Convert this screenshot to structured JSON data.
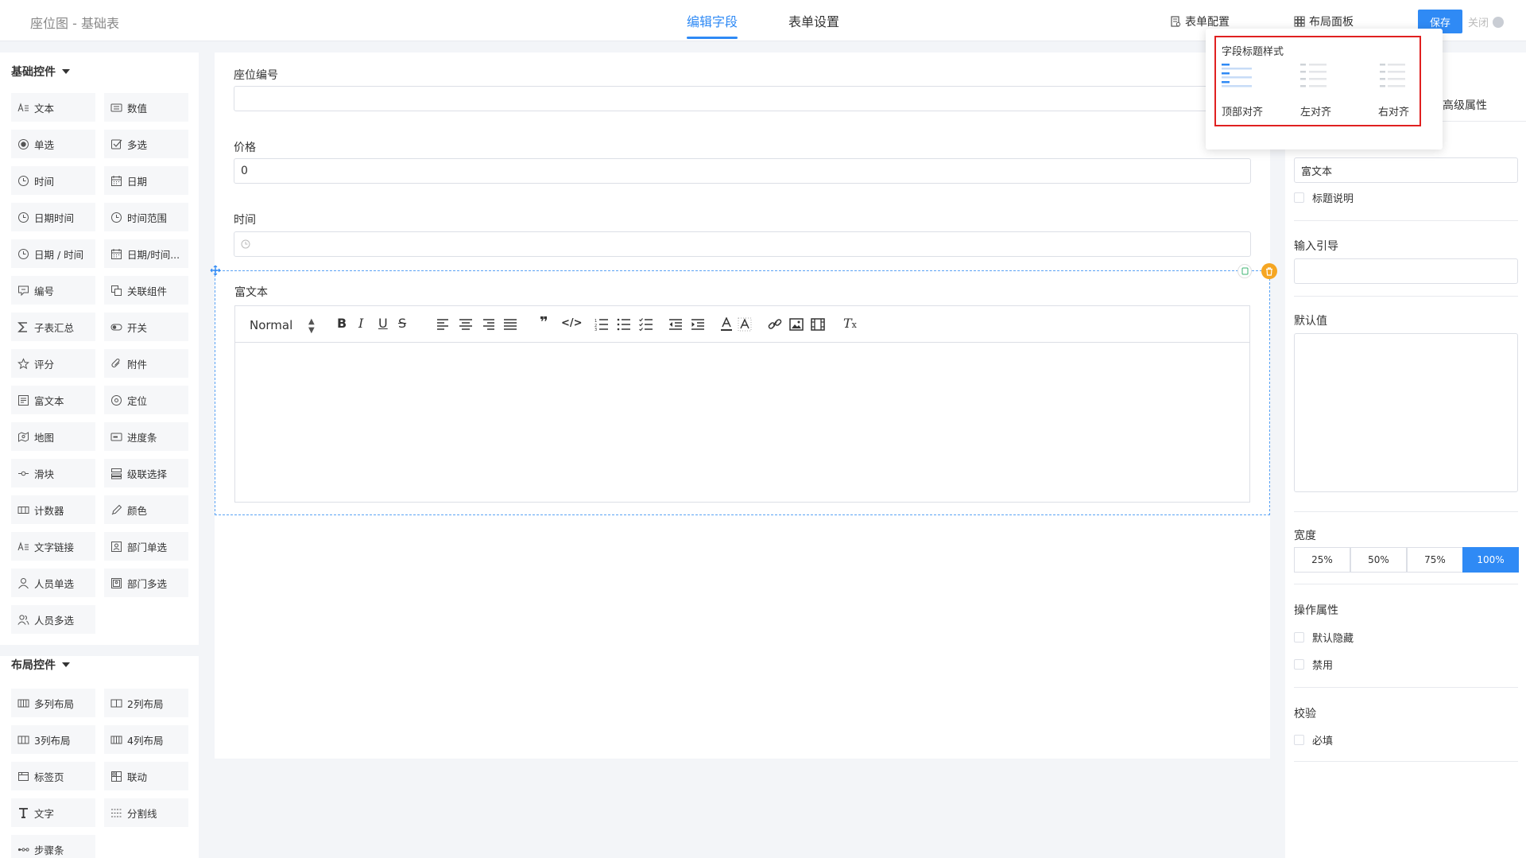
{
  "header": {
    "title": "座位图 - 基础表",
    "tabs": [
      "编辑字段",
      "表单设置"
    ],
    "form_config": "表单配置",
    "layout_panel": "布局面板",
    "save": "保存",
    "close": "关闭",
    "accent_color": "#2f8af5"
  },
  "left_panel": {
    "basic_group": "基础控件",
    "basic_controls": [
      {
        "label": "文本",
        "icon": "text-icon"
      },
      {
        "label": "数值",
        "icon": "number-icon"
      },
      {
        "label": "单选",
        "icon": "radio-icon"
      },
      {
        "label": "多选",
        "icon": "checkbox-icon"
      },
      {
        "label": "时间",
        "icon": "clock-icon"
      },
      {
        "label": "日期",
        "icon": "calendar-icon"
      },
      {
        "label": "日期时间",
        "icon": "clock-icon"
      },
      {
        "label": "时间范围",
        "icon": "clock-icon"
      },
      {
        "label": "日期 / 时间",
        "icon": "clock-icon"
      },
      {
        "label": "日期/时间...",
        "icon": "calendar-icon"
      },
      {
        "label": "编号",
        "icon": "serial-icon"
      },
      {
        "label": "关联组件",
        "icon": "link-component-icon"
      },
      {
        "label": "子表汇总",
        "icon": "sigma-icon"
      },
      {
        "label": "开关",
        "icon": "toggle-icon"
      },
      {
        "label": "评分",
        "icon": "star-icon"
      },
      {
        "label": "附件",
        "icon": "paperclip-icon"
      },
      {
        "label": "富文本",
        "icon": "richtext-icon"
      },
      {
        "label": "定位",
        "icon": "location-icon"
      },
      {
        "label": "地图",
        "icon": "map-icon"
      },
      {
        "label": "进度条",
        "icon": "progress-icon"
      },
      {
        "label": "滑块",
        "icon": "slider-icon"
      },
      {
        "label": "级联选择",
        "icon": "cascade-icon"
      },
      {
        "label": "计数器",
        "icon": "counter-icon"
      },
      {
        "label": "颜色",
        "icon": "color-picker-icon"
      },
      {
        "label": "文字链接",
        "icon": "text-link-icon"
      },
      {
        "label": "部门单选",
        "icon": "department-icon"
      },
      {
        "label": "人员单选",
        "icon": "user-icon"
      },
      {
        "label": "部门多选",
        "icon": "department-multi-icon"
      },
      {
        "label": "人员多选",
        "icon": "users-icon"
      }
    ],
    "layout_group": "布局控件",
    "layout_controls": [
      {
        "label": "多列布局",
        "icon": "columns-icon"
      },
      {
        "label": "2列布局",
        "icon": "two-columns-icon"
      },
      {
        "label": "3列布局",
        "icon": "three-columns-icon"
      },
      {
        "label": "4列布局",
        "icon": "four-columns-icon"
      },
      {
        "label": "标签页",
        "icon": "tabs-icon"
      },
      {
        "label": "联动",
        "icon": "grid-icon"
      },
      {
        "label": "文字",
        "icon": "text-t-icon"
      },
      {
        "label": "分割线",
        "icon": "divider-icon"
      },
      {
        "label": "步骤条",
        "icon": "steps-icon"
      }
    ]
  },
  "canvas": {
    "fields": [
      {
        "label": "座位编号",
        "value": ""
      },
      {
        "label": "价格",
        "value": "0"
      },
      {
        "label": "时间",
        "value": ""
      }
    ],
    "rich_text": {
      "label": "富文本",
      "format": "Normal"
    }
  },
  "popover": {
    "title": "字段标题样式",
    "options": [
      "顶部对齐",
      "左对齐",
      "右对齐"
    ]
  },
  "right_panel": {
    "advanced_tab": "高级属性",
    "title_value": "富文本",
    "title_desc": "标题说明",
    "placeholder_label": "输入引导",
    "placeholder_value": "",
    "default_label": "默认值",
    "width_label": "宽度",
    "width_options": [
      "25%",
      "50%",
      "75%",
      "100%"
    ],
    "width_selected": "100%",
    "op_label": "操作属性",
    "op_options": [
      "默认隐藏",
      "禁用"
    ],
    "validate_label": "校验",
    "validate_options": [
      "必填"
    ]
  }
}
